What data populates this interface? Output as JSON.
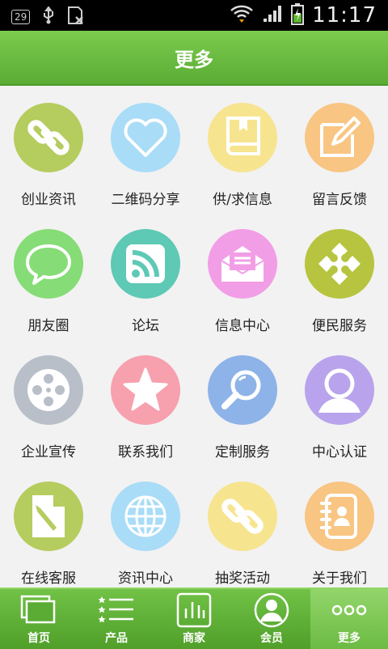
{
  "status": {
    "time": "11:17",
    "badge": "29"
  },
  "header": {
    "title": "更多"
  },
  "grid": [
    {
      "label": "创业资讯",
      "icon": "link-icon",
      "color": "#b5cc5e"
    },
    {
      "label": "二维码分享",
      "icon": "heart-icon",
      "color": "#a9dcf7"
    },
    {
      "label": "供/求信息",
      "icon": "book-icon",
      "color": "#f7e48f"
    },
    {
      "label": "留言反馈",
      "icon": "edit-icon",
      "color": "#f8c582"
    },
    {
      "label": "朋友圈",
      "icon": "chat-bubble-icon",
      "color": "#86dc76"
    },
    {
      "label": "论坛",
      "icon": "rss-icon",
      "color": "#5ec9b5"
    },
    {
      "label": "信息中心",
      "icon": "envelope-icon",
      "color": "#f29ee6"
    },
    {
      "label": "便民服务",
      "icon": "puzzle-icon",
      "color": "#b7c43f"
    },
    {
      "label": "企业宣传",
      "icon": "film-reel-icon",
      "color": "#b8bfc9"
    },
    {
      "label": "联系我们",
      "icon": "star-icon",
      "color": "#f7a0ae"
    },
    {
      "label": "定制服务",
      "icon": "magnifier-icon",
      "color": "#8db3e8"
    },
    {
      "label": "中心认证",
      "icon": "user-icon",
      "color": "#b8a3ec"
    },
    {
      "label": "在线客服",
      "icon": "document-pen-icon",
      "color": "#b5cc5e"
    },
    {
      "label": "资讯中心",
      "icon": "globe-icon",
      "color": "#a9dcf7"
    },
    {
      "label": "抽奖活动",
      "icon": "link-icon",
      "color": "#f7e48f"
    },
    {
      "label": "关于我们",
      "icon": "contact-book-icon",
      "color": "#f8c582"
    }
  ],
  "tabs": [
    {
      "label": "首页",
      "icon": "home-window-icon"
    },
    {
      "label": "产品",
      "icon": "list-stars-icon"
    },
    {
      "label": "商家",
      "icon": "bar-chart-icon"
    },
    {
      "label": "会员",
      "icon": "member-icon"
    },
    {
      "label": "更多",
      "icon": "more-dots-icon",
      "active": true
    }
  ]
}
